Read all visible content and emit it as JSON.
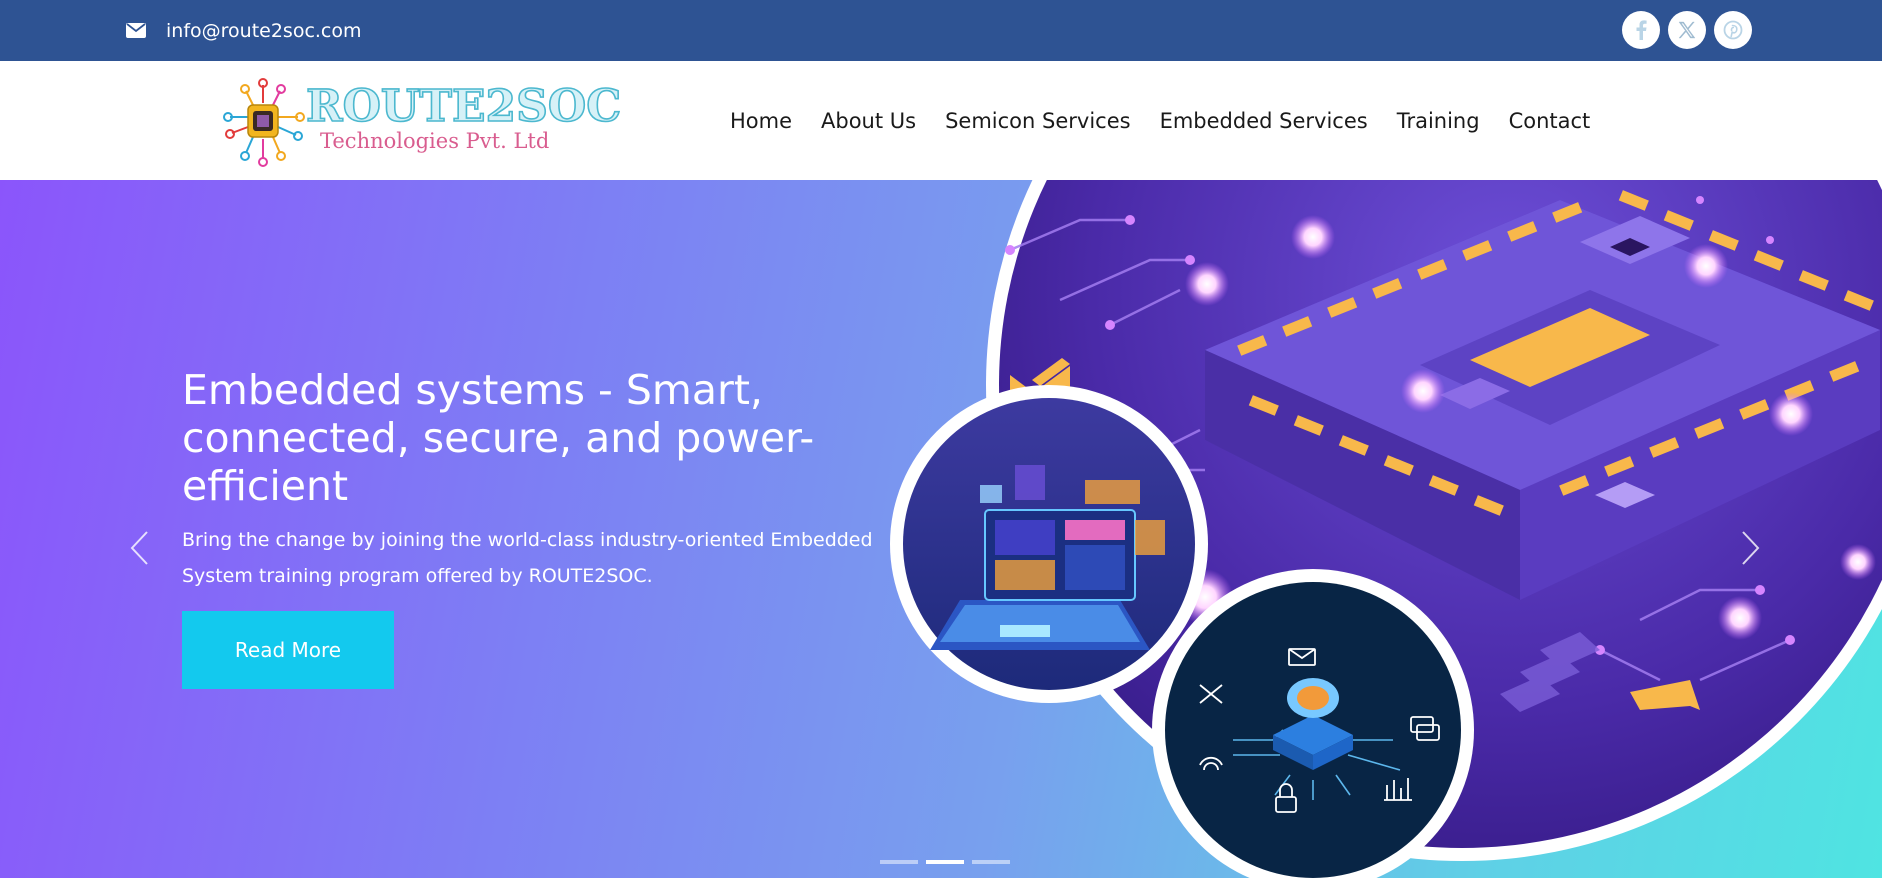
{
  "topbar": {
    "email": "info@route2soc.com",
    "socials": [
      {
        "name": "facebook",
        "icon": "facebook-icon"
      },
      {
        "name": "x",
        "icon": "x-twitter-icon"
      },
      {
        "name": "pinterest",
        "icon": "pinterest-icon"
      }
    ]
  },
  "brand": {
    "name": "ROUTE2SOC",
    "subtitle": "Technologies Pvt. Ltd"
  },
  "nav": {
    "items": [
      "Home",
      "About Us",
      "Semicon Services",
      "Embedded Services",
      "Training",
      "Contact"
    ]
  },
  "hero": {
    "title": "Embedded systems - Smart, connected, secure, and power-efficient",
    "description": "Bring the change by joining the world-class industry-oriented Embedded System training program offered by ROUTE2SOC.",
    "button_label": "Read More",
    "slide_count": 3,
    "active_slide": 2
  },
  "colors": {
    "topbar": "#2e5393",
    "button": "#13c9ee",
    "hero_gradient_start": "#8b55fb",
    "hero_gradient_end": "#4fe4e2"
  }
}
